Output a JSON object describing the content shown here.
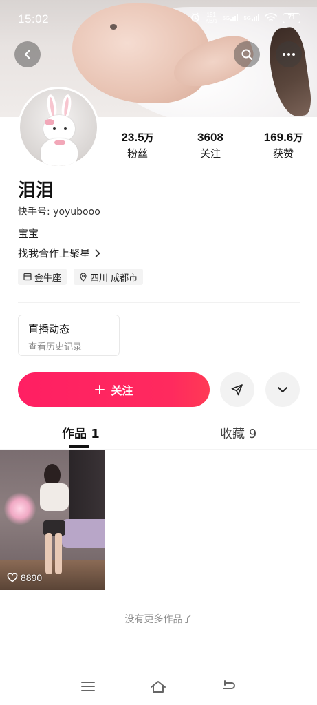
{
  "status_bar": {
    "time": "15:02",
    "net_speed_value": "191",
    "net_speed_unit": "KB/s",
    "sig1_label": "5G",
    "sig2_label": "5G",
    "battery": "71"
  },
  "profile": {
    "stats": [
      {
        "num": "23.5",
        "unit": "万",
        "label": "粉丝"
      },
      {
        "num": "3608",
        "unit": "",
        "label": "关注"
      },
      {
        "num": "169.6",
        "unit": "万",
        "label": "获赞"
      }
    ],
    "nickname": "泪泪",
    "kuaishou_id": "快手号: yoyubooo",
    "bio": "宝宝",
    "cooperate": "找我合作上聚星",
    "tags": [
      "金牛座",
      "四川 成都市"
    ]
  },
  "live_card": {
    "title": "直播动态",
    "subtitle": "查看历史记录"
  },
  "actions": {
    "follow_label": "关注"
  },
  "tabs": {
    "works": "作品 1",
    "collect": "收藏 9"
  },
  "works": [
    {
      "likes": "8890"
    }
  ],
  "footer": {
    "no_more": "没有更多作品了"
  },
  "colors": {
    "accent": "#ff2a5e",
    "text_primary": "#111111",
    "text_secondary": "#8a8a8a"
  }
}
